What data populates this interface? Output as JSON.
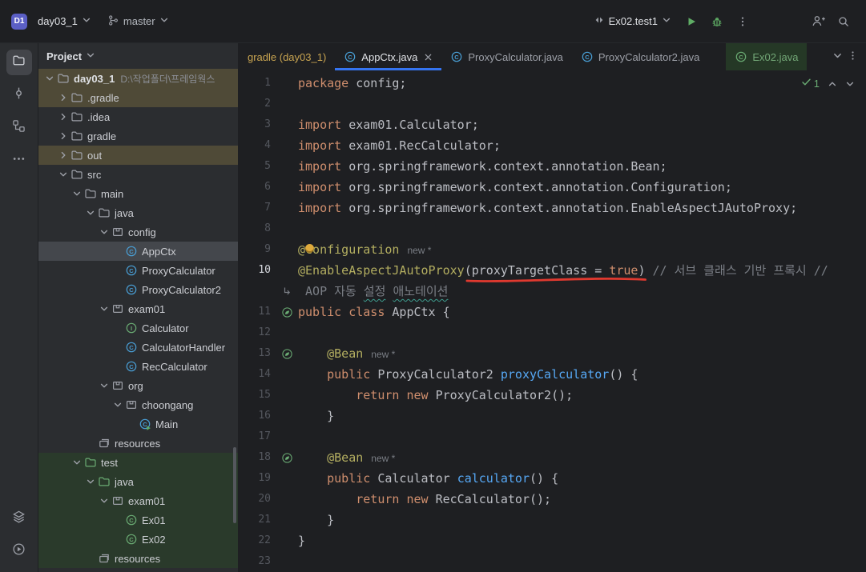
{
  "colors": {
    "accent_blue": "#3574f0",
    "run_green": "#5fad65",
    "marker_red": "#e0392f",
    "annotation_yellow": "#b3ae60",
    "keyword_orange": "#cf8e6d",
    "comment_gray": "#7a7e85",
    "method_blue": "#56a8f5",
    "tab_green_bg": "#253826",
    "row_olive": "#4f4a37",
    "row_green": "#2a3a2b",
    "row_selected": "#44474c"
  },
  "titlebar": {
    "project_badge": "D1",
    "project_name": "day03_1",
    "branch": "master",
    "run_config": "Ex02.test1"
  },
  "stripe": {
    "top": [
      {
        "name": "project",
        "active": true
      },
      {
        "name": "commit",
        "active": false
      },
      {
        "name": "structure",
        "active": false
      },
      {
        "name": "more",
        "active": false
      }
    ],
    "bottom": [
      {
        "name": "services",
        "active": false
      },
      {
        "name": "run",
        "active": false
      }
    ]
  },
  "project": {
    "title": "Project",
    "items": [
      {
        "label": "day03_1",
        "path": "D:\\작업폴더\\프레임웍스",
        "level": 0,
        "icon": "folder",
        "chev": "down",
        "bg": "olive",
        "bold": true
      },
      {
        "label": ".gradle",
        "level": 1,
        "icon": "folder",
        "chev": "right",
        "bg": "olive"
      },
      {
        "label": ".idea",
        "level": 1,
        "icon": "folder",
        "chev": "right"
      },
      {
        "label": "gradle",
        "level": 1,
        "icon": "folder",
        "chev": "right"
      },
      {
        "label": "out",
        "level": 1,
        "icon": "folder",
        "chev": "right",
        "bg": "olive"
      },
      {
        "label": "src",
        "level": 1,
        "icon": "folder",
        "chev": "down"
      },
      {
        "label": "main",
        "level": 2,
        "icon": "folder",
        "chev": "down"
      },
      {
        "label": "java",
        "level": 3,
        "icon": "folder",
        "chev": "down"
      },
      {
        "label": "config",
        "level": 4,
        "icon": "package",
        "chev": "down"
      },
      {
        "label": "AppCtx",
        "level": 5,
        "icon": "class",
        "bg": "selected"
      },
      {
        "label": "ProxyCalculator",
        "level": 5,
        "icon": "class"
      },
      {
        "label": "ProxyCalculator2",
        "level": 5,
        "icon": "class"
      },
      {
        "label": "exam01",
        "level": 4,
        "icon": "package",
        "chev": "down"
      },
      {
        "label": "Calculator",
        "level": 5,
        "icon": "interface"
      },
      {
        "label": "CalculatorHandler",
        "level": 5,
        "icon": "class"
      },
      {
        "label": "RecCalculator",
        "level": 5,
        "icon": "class"
      },
      {
        "label": "org",
        "level": 4,
        "icon": "package",
        "chev": "down"
      },
      {
        "label": "choongang",
        "level": 5,
        "icon": "package",
        "chev": "down"
      },
      {
        "label": "Main",
        "level": 6,
        "icon": "class-run"
      },
      {
        "label": "resources",
        "level": 3,
        "icon": "resources"
      },
      {
        "label": "test",
        "level": 2,
        "icon": "folder-green",
        "chev": "down",
        "bg": "green"
      },
      {
        "label": "java",
        "level": 3,
        "icon": "folder-green",
        "chev": "down",
        "bg": "green"
      },
      {
        "label": "exam01",
        "level": 4,
        "icon": "package",
        "chev": "down",
        "bg": "green"
      },
      {
        "label": "Ex01",
        "level": 5,
        "icon": "class-test",
        "bg": "green"
      },
      {
        "label": "Ex02",
        "level": 5,
        "icon": "class-test",
        "bg": "green"
      },
      {
        "label": "resources",
        "level": 3,
        "icon": "resources",
        "bg": "green"
      }
    ]
  },
  "tabs": {
    "items": [
      {
        "label": "gradle (day03_1)",
        "style": "gradle"
      },
      {
        "label": "AppCtx.java",
        "icon": "class",
        "active": true,
        "closable": true
      },
      {
        "label": "ProxyCalculator.java",
        "icon": "class"
      },
      {
        "label": "ProxyCalculator2.java",
        "icon": "class"
      },
      {
        "label": "Ex02.java",
        "icon": "class-test",
        "style": "green",
        "gap": true
      }
    ]
  },
  "editor": {
    "inspection_count": "1",
    "lines": [
      {
        "n": "1",
        "tokens": [
          {
            "t": "package",
            "c": "kw"
          },
          {
            "t": " config;",
            "c": "def"
          }
        ]
      },
      {
        "n": "2",
        "tokens": []
      },
      {
        "n": "3",
        "tokens": [
          {
            "t": "import",
            "c": "kw"
          },
          {
            "t": " exam01.Calculator;",
            "c": "def"
          }
        ]
      },
      {
        "n": "4",
        "tokens": [
          {
            "t": "import",
            "c": "kw"
          },
          {
            "t": " exam01.RecCalculator;",
            "c": "def"
          }
        ]
      },
      {
        "n": "5",
        "tokens": [
          {
            "t": "import",
            "c": "kw"
          },
          {
            "t": " org.springframework.context.annotation.Bean;",
            "c": "def"
          }
        ]
      },
      {
        "n": "6",
        "tokens": [
          {
            "t": "import",
            "c": "kw"
          },
          {
            "t": " org.springframework.context.annotation.Configuration;",
            "c": "def"
          }
        ]
      },
      {
        "n": "7",
        "tokens": [
          {
            "t": "import",
            "c": "kw"
          },
          {
            "t": " org.springframework.context.annotation.EnableAspectJAutoProxy;",
            "c": "def"
          }
        ]
      },
      {
        "n": "8",
        "tokens": []
      },
      {
        "n": "9",
        "bulb": true,
        "tokens": [
          {
            "t": "@Configuration",
            "c": "ann"
          },
          {
            "t": "new *",
            "c": "hint"
          }
        ]
      },
      {
        "n": "10",
        "current": true,
        "marker": {
          "left_ch": 23,
          "width_ch": 25.3
        },
        "tokens": [
          {
            "t": "@EnableAspectJAutoProxy",
            "c": "ann"
          },
          {
            "t": "(proxyTargetClass = ",
            "c": "def"
          },
          {
            "t": "true",
            "c": "kw"
          },
          {
            "t": ")",
            "c": "def"
          },
          {
            "t": " // 서브 클래스 기반 프록시 //",
            "c": "com"
          }
        ]
      },
      {
        "n": "",
        "wrap": true,
        "tokens": [
          {
            "t": " AOP 자동 ",
            "c": "com"
          },
          {
            "t": "설정",
            "c": "com typo"
          },
          {
            "t": " ",
            "c": "com"
          },
          {
            "t": "애노테이션",
            "c": "com typo"
          }
        ]
      },
      {
        "n": "11",
        "gutter": "leaf",
        "tokens": [
          {
            "t": "public",
            "c": "kw"
          },
          {
            "t": " ",
            "c": "def"
          },
          {
            "t": "class",
            "c": "kw"
          },
          {
            "t": " AppCtx {",
            "c": "def"
          }
        ]
      },
      {
        "n": "12",
        "tokens": []
      },
      {
        "n": "13",
        "gutter": "leaf",
        "tokens": [
          {
            "t": "    ",
            "c": "def"
          },
          {
            "t": "@Bean",
            "c": "ann"
          },
          {
            "t": "new *",
            "c": "hint"
          }
        ]
      },
      {
        "n": "14",
        "tokens": [
          {
            "t": "    ",
            "c": "def"
          },
          {
            "t": "public",
            "c": "kw"
          },
          {
            "t": " ProxyCalculator2 ",
            "c": "def"
          },
          {
            "t": "proxyCalculator",
            "c": "meth"
          },
          {
            "t": "() {",
            "c": "def"
          }
        ]
      },
      {
        "n": "15",
        "tokens": [
          {
            "t": "        ",
            "c": "def"
          },
          {
            "t": "return",
            "c": "kw"
          },
          {
            "t": " ",
            "c": "def"
          },
          {
            "t": "new",
            "c": "kw"
          },
          {
            "t": " ProxyCalculator2();",
            "c": "def"
          }
        ]
      },
      {
        "n": "16",
        "tokens": [
          {
            "t": "    }",
            "c": "def"
          }
        ]
      },
      {
        "n": "17",
        "tokens": []
      },
      {
        "n": "18",
        "gutter": "leaf",
        "tokens": [
          {
            "t": "    ",
            "c": "def"
          },
          {
            "t": "@Bean",
            "c": "ann"
          },
          {
            "t": "new *",
            "c": "hint"
          }
        ]
      },
      {
        "n": "19",
        "tokens": [
          {
            "t": "    ",
            "c": "def"
          },
          {
            "t": "public",
            "c": "kw"
          },
          {
            "t": " Calculator ",
            "c": "def"
          },
          {
            "t": "calculator",
            "c": "meth"
          },
          {
            "t": "() {",
            "c": "def"
          }
        ]
      },
      {
        "n": "20",
        "tokens": [
          {
            "t": "        ",
            "c": "def"
          },
          {
            "t": "return",
            "c": "kw"
          },
          {
            "t": " ",
            "c": "def"
          },
          {
            "t": "new",
            "c": "kw"
          },
          {
            "t": " RecCalculator();",
            "c": "def"
          }
        ]
      },
      {
        "n": "21",
        "tokens": [
          {
            "t": "    }",
            "c": "def"
          }
        ]
      },
      {
        "n": "22",
        "tokens": [
          {
            "t": "}",
            "c": "def"
          }
        ]
      },
      {
        "n": "23",
        "tokens": []
      }
    ]
  }
}
